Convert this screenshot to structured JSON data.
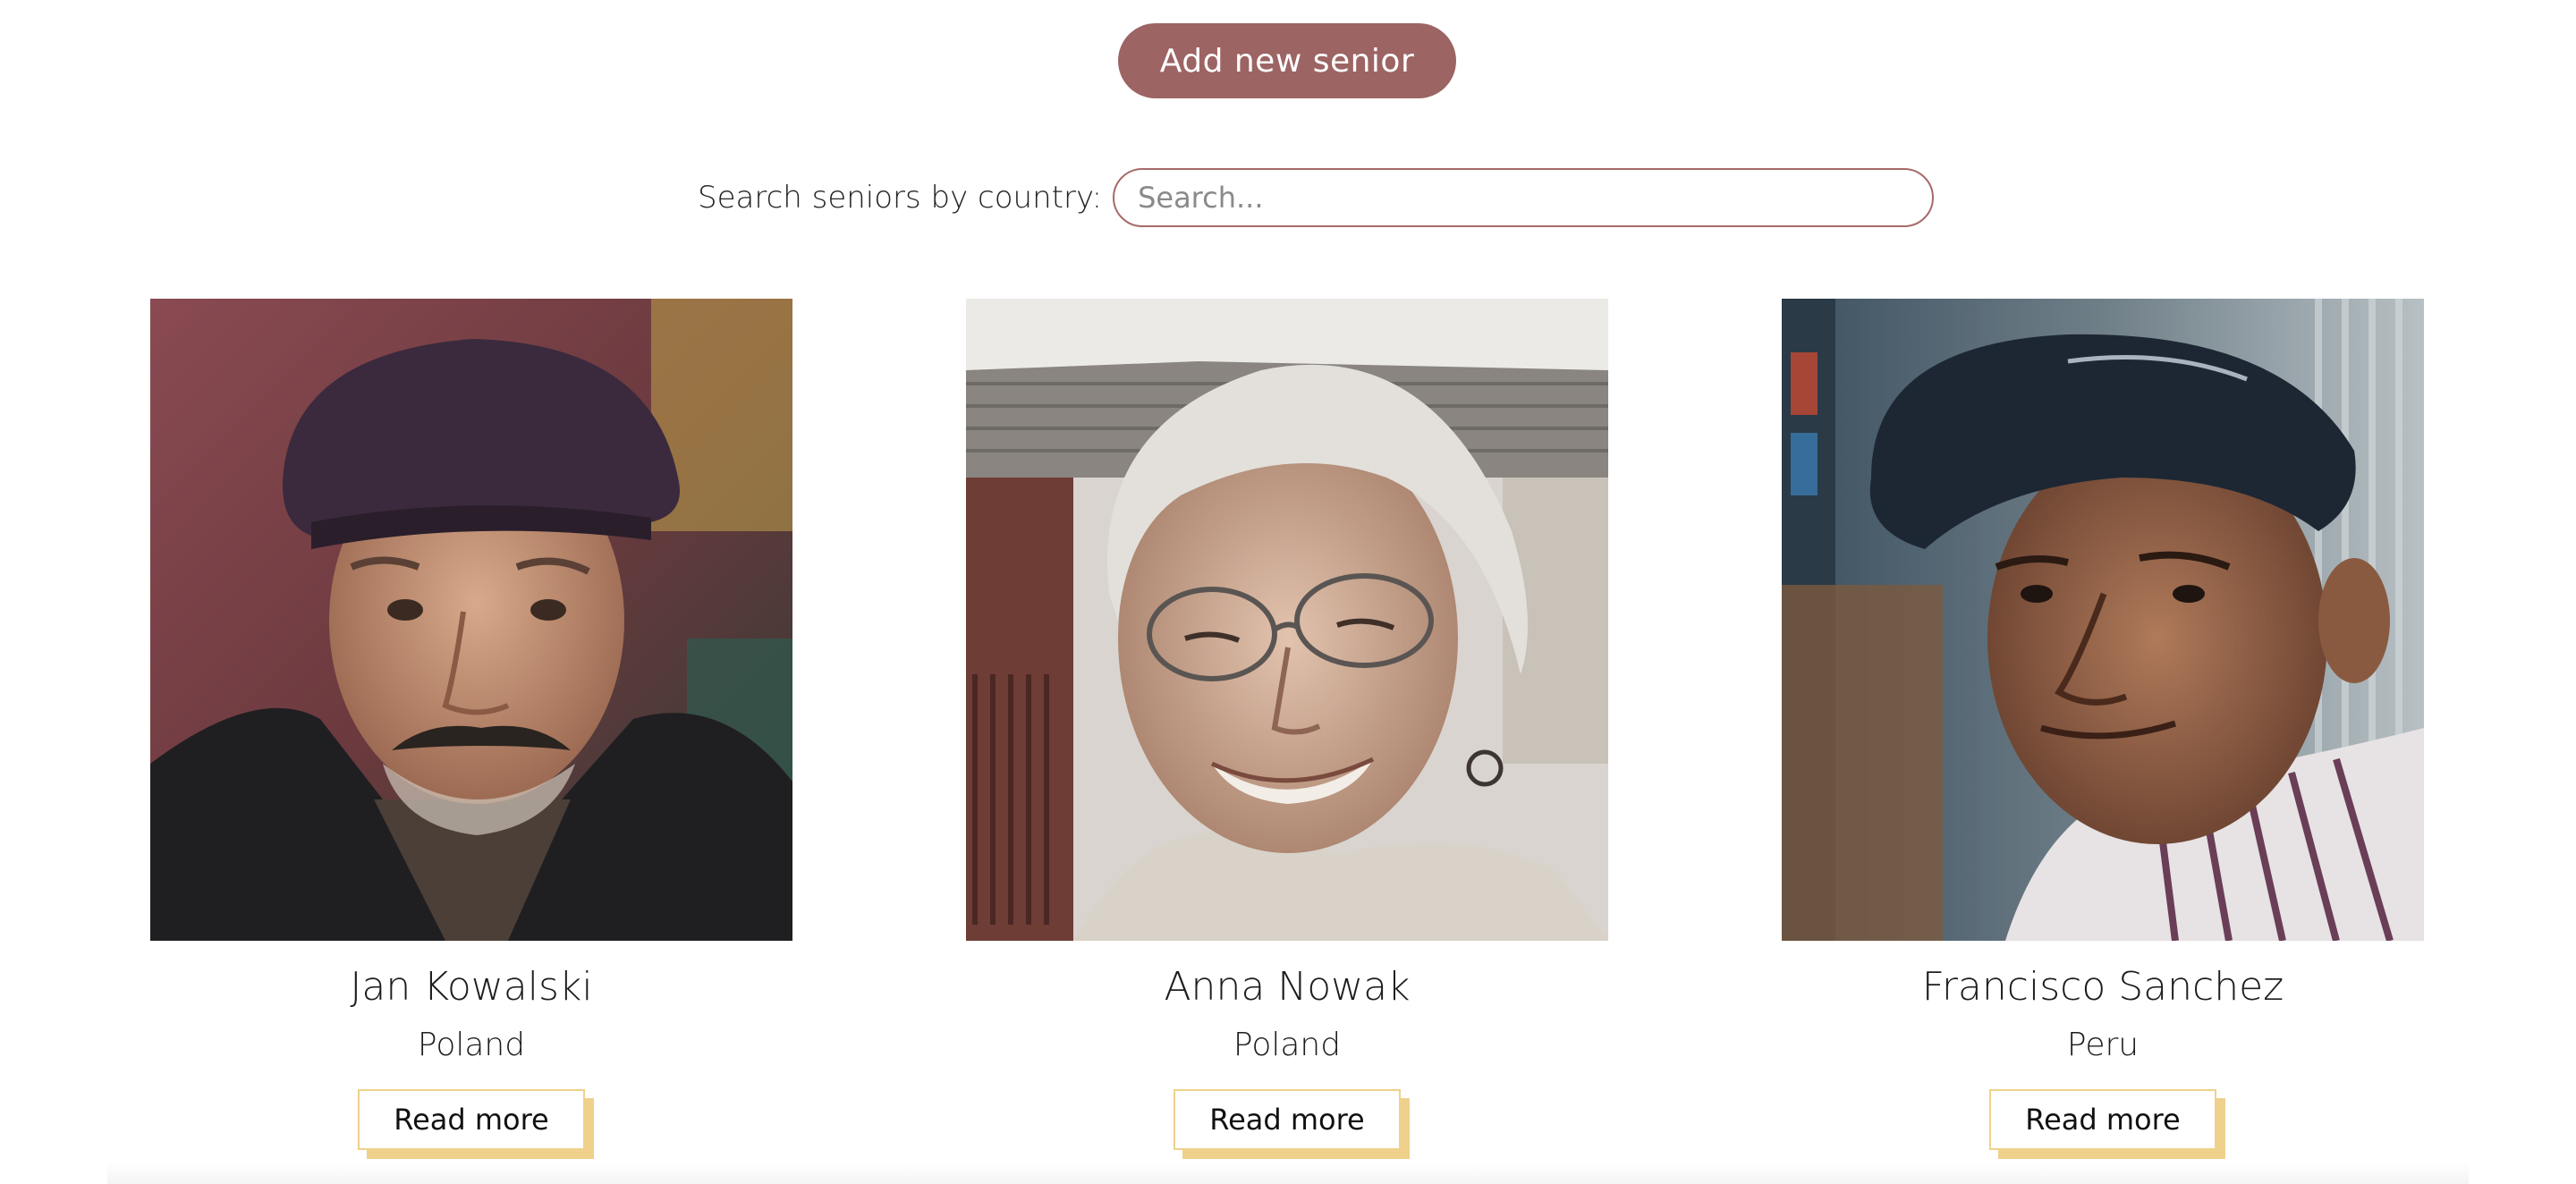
{
  "header": {
    "add_button_label": "Add new senior"
  },
  "search": {
    "label": "Search seniors by country:",
    "placeholder": "Search...",
    "value": ""
  },
  "seniors": [
    {
      "name": "Jan Kowalski",
      "country": "Poland",
      "read_more_label": "Read more"
    },
    {
      "name": "Anna Nowak",
      "country": "Poland",
      "read_more_label": "Read more"
    },
    {
      "name": "Francisco Sanchez",
      "country": "Peru",
      "read_more_label": "Read more"
    }
  ],
  "colors": {
    "primary": "#9c6463",
    "accent": "#efd18c",
    "search_border": "#a66a69"
  }
}
